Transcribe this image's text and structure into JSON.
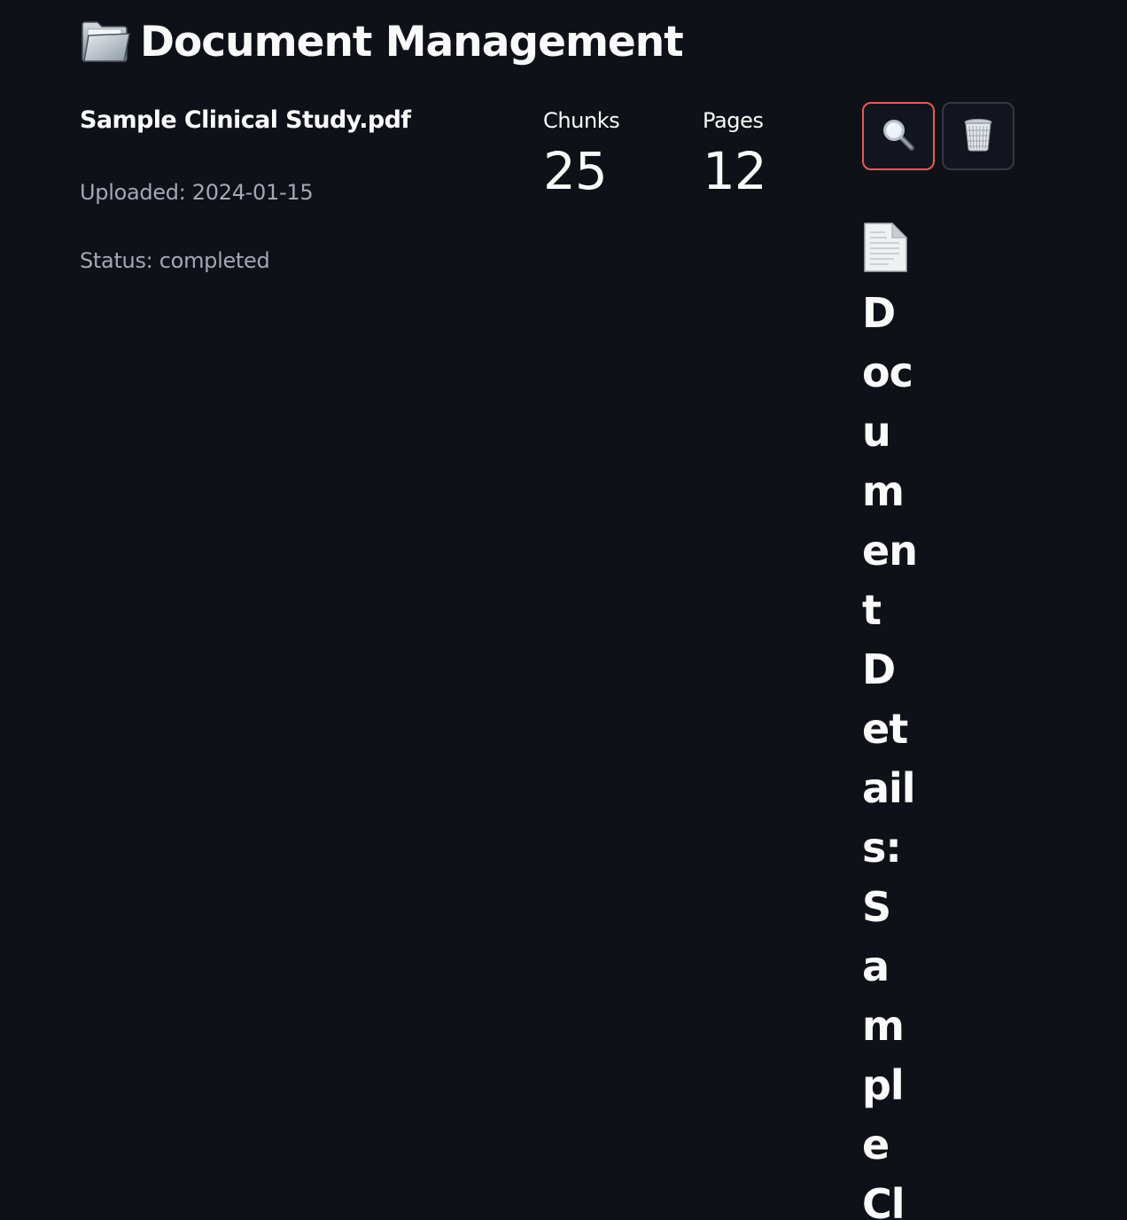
{
  "header": {
    "icon": "folder-icon",
    "title": "Document Management"
  },
  "document": {
    "name": "Sample Clinical Study.pdf",
    "uploaded": "Uploaded: 2024-01-15",
    "status": "Status: completed",
    "metrics": {
      "chunks_label": "Chunks",
      "chunks_value": "25",
      "pages_label": "Pages",
      "pages_value": "12"
    },
    "actions": {
      "view_icon": "magnifying-glass-icon",
      "delete_icon": "wastebasket-icon"
    }
  },
  "details": {
    "icon": "page-icon",
    "heading": "Document Details: Sample Cl"
  },
  "colors": {
    "background": "#0e1117",
    "text": "#fafafa",
    "muted_text": "#a3a8b4",
    "focus_border": "#e75a5a"
  }
}
